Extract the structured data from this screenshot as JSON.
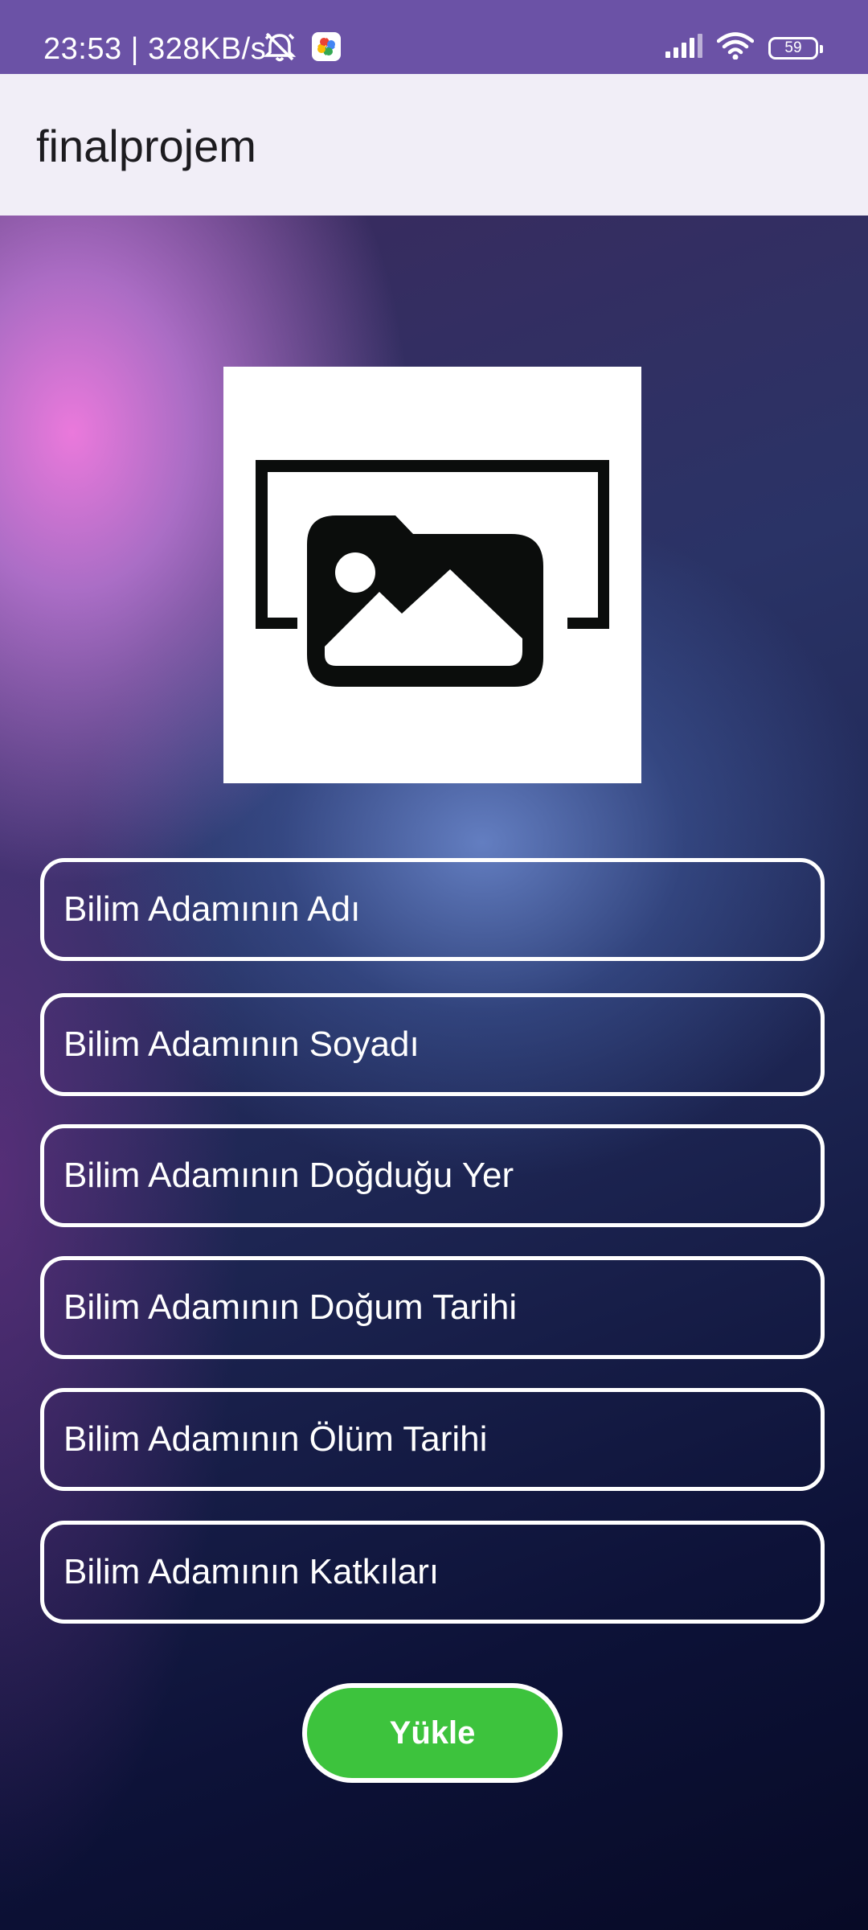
{
  "status_bar": {
    "time_speed": "23:53 | 328KB/s",
    "battery": "59",
    "icons": [
      "mute-alarm-icon",
      "photos-app-icon",
      "signal-icon",
      "wifi-icon",
      "battery-icon"
    ]
  },
  "app_bar": {
    "title": "finalprojem"
  },
  "image_picker": {
    "icon": "image-placeholder-icon"
  },
  "form": {
    "fields": [
      {
        "placeholder": "Bilim Adamının Adı"
      },
      {
        "placeholder": "Bilim Adamının Soyadı"
      },
      {
        "placeholder": "Bilim Adamının Doğduğu Yer"
      },
      {
        "placeholder": "Bilim Adamının Doğum Tarihi"
      },
      {
        "placeholder": "Bilim Adamının Ölüm Tarihi"
      },
      {
        "placeholder": "Bilim Adamının Katkıları"
      }
    ],
    "submit_label": "Yükle"
  },
  "colors": {
    "status_bar": "#6b52a6",
    "app_bar": "#f1eef7",
    "button": "#3dc33d",
    "field_border": "#ffffff"
  }
}
